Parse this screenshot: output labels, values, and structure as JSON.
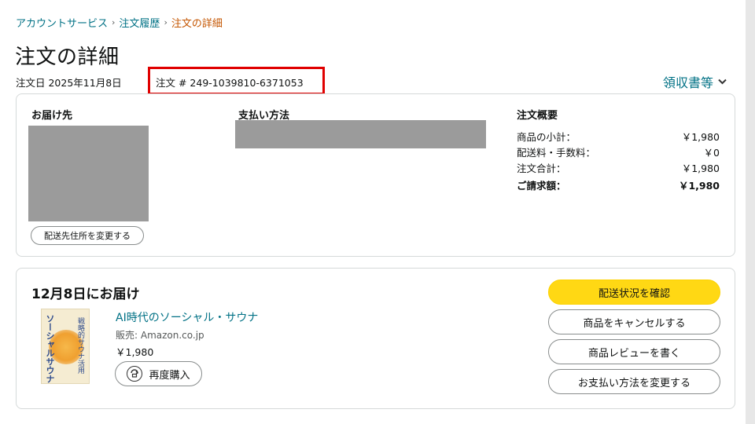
{
  "breadcrumb": {
    "items": [
      "アカウントサービス",
      "注文履歴"
    ],
    "current": "注文の詳細",
    "separator": "›"
  },
  "page": {
    "title": "注文の詳細",
    "order_date": "注文日 2025年11月8日",
    "order_number": "注文 # 249-1039810-6371053",
    "receipt_label": "領収書等",
    "receipt_chevron": "chevron-down-icon"
  },
  "summary": {
    "ship_to_label": "お届け先",
    "change_address_label": "配送先住所を変更する",
    "payment_label": "支払い方法",
    "order_summary_label": "注文概要",
    "rows": [
      {
        "label": "商品の小計：",
        "value": "￥1,980"
      },
      {
        "label": "配送料・手数料：",
        "value": "￥0"
      },
      {
        "label": "注文合計：",
        "value": "￥1,980"
      },
      {
        "label": "ご請求額：",
        "value": "￥1,980"
      }
    ]
  },
  "delivery": {
    "title": "12月8日にお届け",
    "product": {
      "title": "AI時代のソーシャル・サウナ",
      "seller": "販売: Amazon.co.jp",
      "price": "￥1,980",
      "cover_text_main": "ソーシャルサウナ",
      "cover_text_sub": "戦略的サウナ活用",
      "rebuy_label": "再度購入",
      "rebuy_icon": "rebuy-icon"
    },
    "actions": [
      {
        "label": "配送状況を確認",
        "primary": true
      },
      {
        "label": "商品をキャンセルする",
        "primary": false
      },
      {
        "label": "商品レビューを書く",
        "primary": false
      },
      {
        "label": "お支払い方法を変更する",
        "primary": false
      }
    ]
  },
  "colors": {
    "link": "#007185",
    "current_crumb": "#c45500",
    "highlight_box": "#e00000",
    "primary_button": "#ffd814",
    "redacted": "#9b9b9b"
  }
}
